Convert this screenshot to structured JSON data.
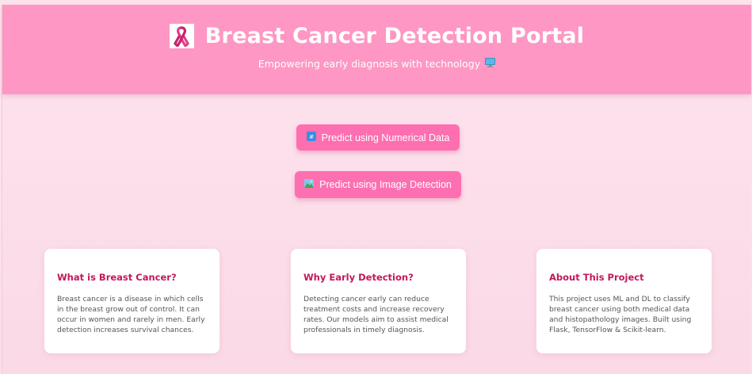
{
  "header": {
    "title": "Breast Cancer Detection Portal",
    "subtitle": "Empowering early diagnosis with technology",
    "title_icon": "pink-ribbon-icon",
    "subtitle_icon": "computer-monitor-icon"
  },
  "actions": {
    "numerical": {
      "label": "Predict using Numerical Data",
      "icon": "numbers-icon"
    },
    "image": {
      "label": "Predict using Image Detection",
      "icon": "picture-icon"
    }
  },
  "cards": [
    {
      "title": "What is Breast Cancer?",
      "body": "Breast cancer is a disease in which cells in the breast grow out of control. It can occur in women and rarely in men. Early detection increases survival chances."
    },
    {
      "title": "Why Early Detection?",
      "body": "Detecting cancer early can reduce treatment costs and increase recovery rates. Our models aim to assist medical professionals in timely diagnosis."
    },
    {
      "title": "About This Project",
      "body": "This project uses ML and DL to classify breast cancer using both medical data and histopathology images. Built using Flask, TensorFlow & Scikit-learn."
    }
  ],
  "colors": {
    "header_bg": "#fe97c3",
    "button_bg": "#fd6fb0",
    "card_title": "#c2185b",
    "page_bg": "#fce4ee"
  }
}
